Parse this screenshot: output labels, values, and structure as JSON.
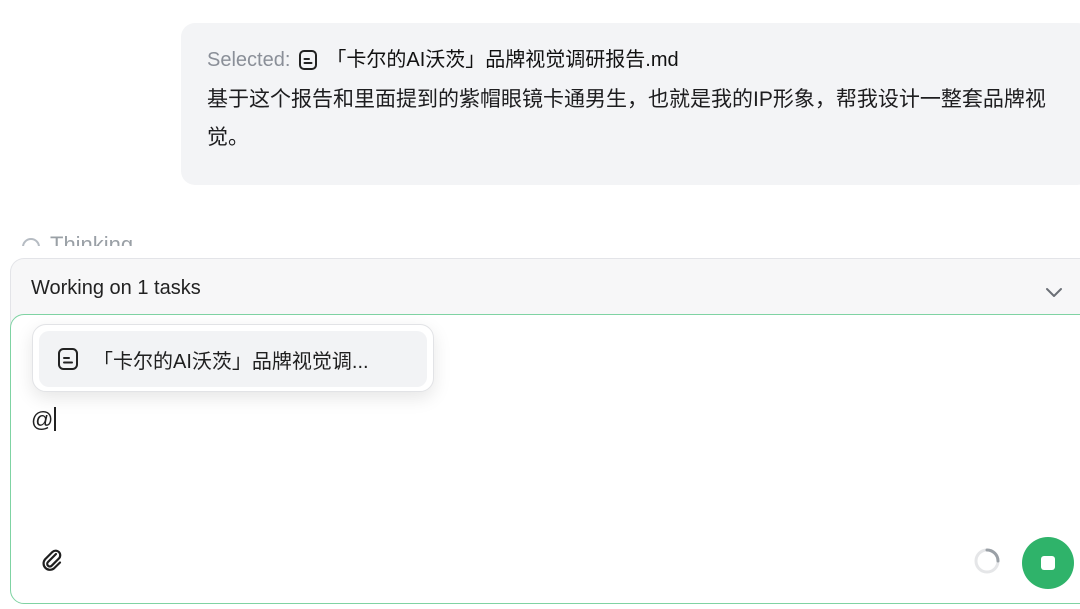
{
  "message": {
    "selected_prefix": "Selected:",
    "selected_file": "「卡尔的AI沃茨」品牌视觉调研报告.md",
    "text": "基于这个报告和里面提到的紫帽眼镜卡通男生，也就是我的IP形象，帮我设计一整套品牌视觉。"
  },
  "thinking": {
    "label": "Thinking"
  },
  "tasks": {
    "label": "Working on 1 tasks"
  },
  "composer": {
    "input_value": "@"
  },
  "mention_popup": {
    "items": [
      {
        "label": "「卡尔的AI沃茨」品牌视觉调...",
        "icon": "document-icon"
      }
    ]
  },
  "icons": {
    "attach": "paperclip-icon",
    "stop": "stop-icon",
    "loading": "spinner-icon",
    "expand": "chevron-down-icon"
  },
  "colors": {
    "accent": "#2fb36a",
    "composer_border": "#7fd3a3",
    "bubble_bg": "#f3f4f6"
  }
}
